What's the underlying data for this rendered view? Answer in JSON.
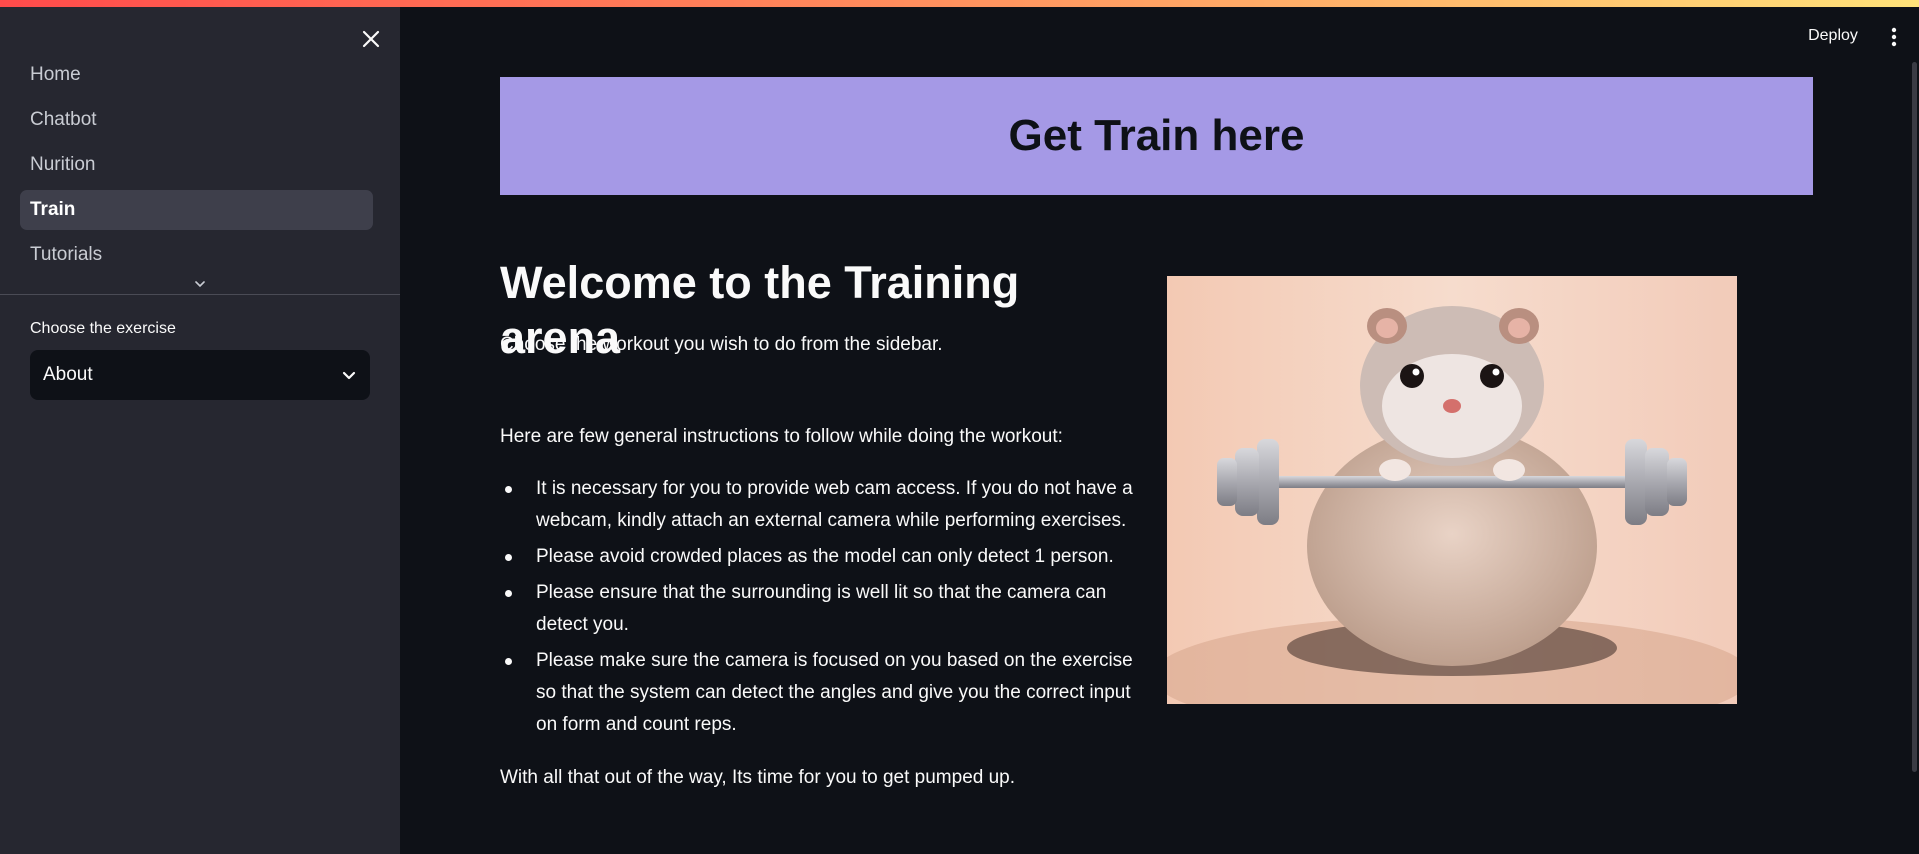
{
  "sidebar": {
    "nav_items": [
      {
        "label": "Home",
        "active": false
      },
      {
        "label": "Chatbot",
        "active": false
      },
      {
        "label": "Nurition",
        "active": false
      },
      {
        "label": "Train",
        "active": true
      },
      {
        "label": "Tutorials",
        "active": false
      }
    ],
    "select_label": "Choose the exercise",
    "select_value": "About"
  },
  "header": {
    "deploy_label": "Deploy"
  },
  "main": {
    "banner_title": "Get Train here",
    "welcome_title": "Welcome to the Training arena",
    "intro": "Choose the workout you wish to do from the sidebar.",
    "instructions_heading": "Here are few general instructions to follow while doing the workout:",
    "instructions": [
      "It is necessary for you to provide web cam access. If you do not have a webcam, kindly attach an external camera while performing exercises.",
      "Please avoid crowded places as the model can only detect 1 person.",
      "Please ensure that the surrounding is well lit so that the camera can detect you.",
      "Please make sure the camera is focused on you based on the exercise so that the system can detect the angles and give you the correct input on form and count reps."
    ],
    "closing": "With all that out of the way, Its time for you to get pumped up."
  },
  "colors": {
    "background": "#0e1117",
    "sidebar": "#262730",
    "banner": "#a599e6",
    "active_nav": "#3e3f4b"
  }
}
